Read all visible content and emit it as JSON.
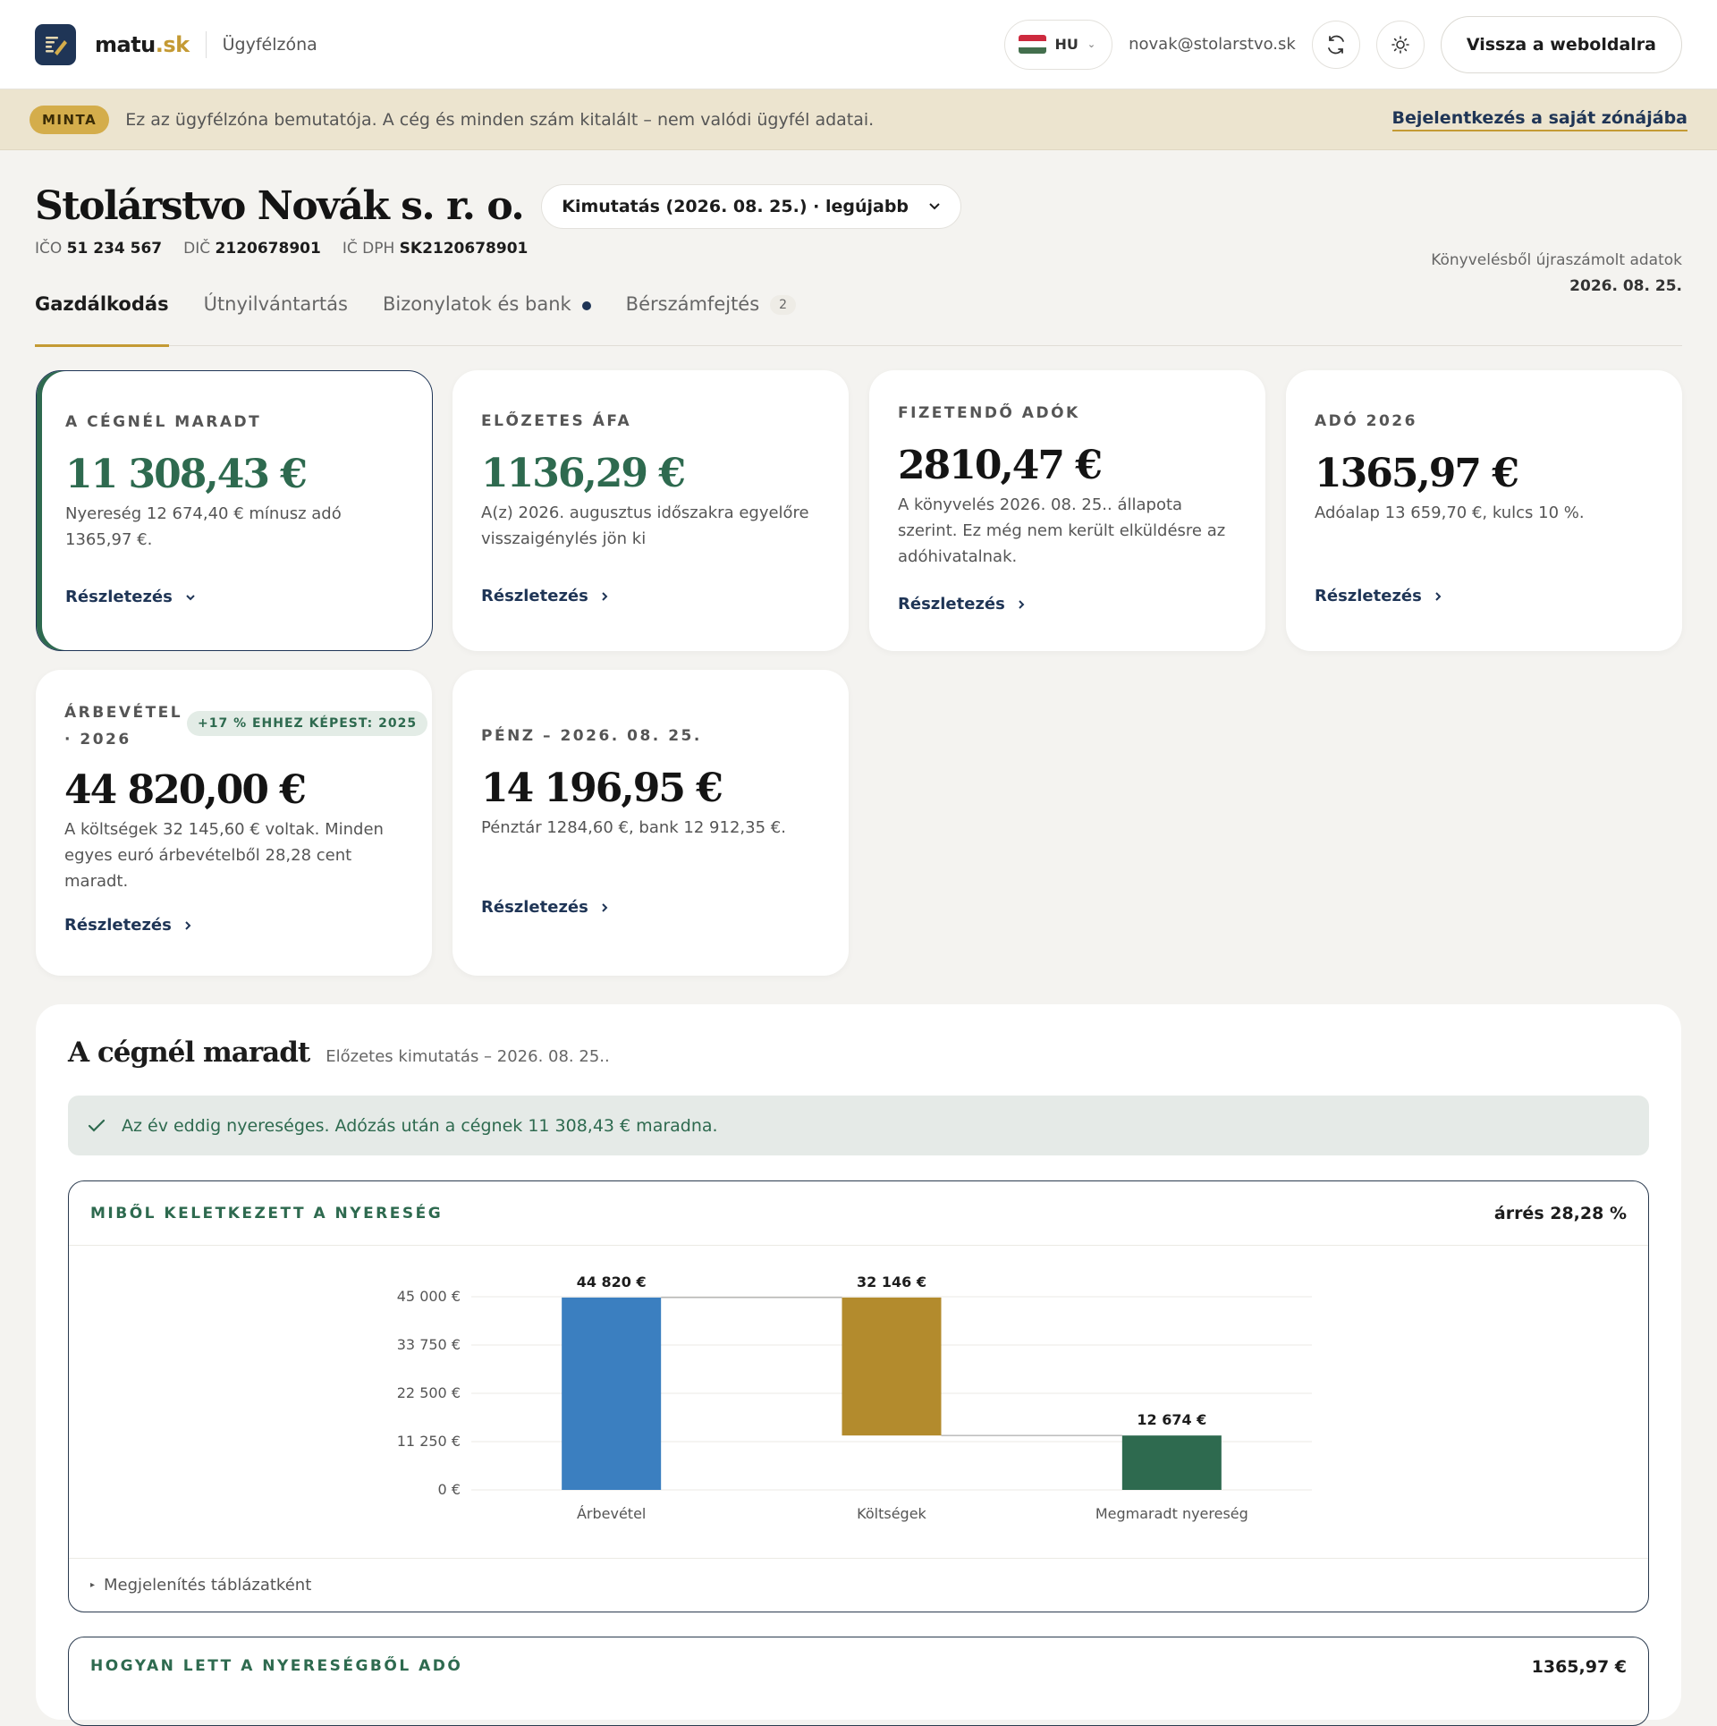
{
  "app": {
    "brand_name": "matu",
    "brand_tld": ".sk",
    "section": "Ügyfélzóna",
    "language": "HU",
    "user_email": "novak@stolarstvo.sk",
    "back_label": "Vissza a weboldalra"
  },
  "banner": {
    "badge": "MINTA",
    "text": "Ez az ügyfélzóna bemutatója. A cég és minden szám kitalált – nem valódi ügyfél adatai.",
    "link": "Bejelentkezés a saját zónájába"
  },
  "company": {
    "name": "Stolárstvo Novák s. r. o.",
    "report_select": "Kimutatás (2026. 08. 25.) · legújabb",
    "ico_label": "IČO",
    "ico": "51 234 567",
    "dic_label": "DIČ",
    "dic": "2120678901",
    "icdph_label": "IČ DPH",
    "icdph": "SK2120678901",
    "recalc_text": "Könyvelésből újraszámolt adatok",
    "recalc_date": "2026. 08. 25."
  },
  "tabs": [
    {
      "label": "Gazdálkodás"
    },
    {
      "label": "Útnyilvántartás"
    },
    {
      "label": "Bizonylatok és bank"
    },
    {
      "label": "Bérszámfejtés",
      "count": "2"
    }
  ],
  "detail_label": "Részletezés",
  "cards": [
    {
      "label": "A cégnél maradt",
      "value": "11 308,43 €",
      "desc": "Nyereség 12 674,40 € mínusz adó 1365,97 €."
    },
    {
      "label": "Előzetes áfa",
      "value": "1136,29 €",
      "desc": "A(z) 2026. augusztus időszakra egyelőre visszaigénylés jön ki"
    },
    {
      "label": "Fizetendő adók",
      "value": "2810,47 €",
      "desc": "A könyvelés 2026. 08. 25.. állapota szerint. Ez még nem került elküldésre az adóhivatalnak."
    },
    {
      "label": "Adó 2026",
      "value": "1365,97 €",
      "desc": "Adóalap 13 659,70 €, kulcs 10 %."
    },
    {
      "label": "Árbevétel · 2026",
      "badge": "+17 % ehhez képest: 2025",
      "value": "44 820,00 €",
      "desc": "A költségek 32 145,60 € voltak. Minden egyes euró árbevételből 28,28 cent maradt."
    },
    {
      "label": "Pénz – 2026. 08. 25.",
      "value": "14 196,95 €",
      "desc": "Pénztár 1284,60 €, bank 12 912,35 €."
    }
  ],
  "profit_panel": {
    "title": "A cégnél maradt",
    "subtitle": "Előzetes kimutatás – 2026. 08. 25..",
    "ok_text": "Az év eddig nyereséges. Adózás után a cégnek 11 308,43 € maradna.",
    "chart_title": "Miből keletkezett a nyereség",
    "margin": "árrés 28,28 %",
    "table_toggle": "Megjelenítés táblázatként",
    "next_title": "Hogyan lett a nyereségből adó",
    "next_value": "1365,97 €"
  },
  "colors": {
    "revenue": "#3b7fc0",
    "costs": "#b38b2d",
    "profit": "#2e6a4f",
    "accent_gold": "#c49a34",
    "navy": "#1f3556"
  },
  "chart_data": {
    "type": "bar",
    "categories": [
      "Árbevétel",
      "Költségek",
      "Megmaradt nyereség"
    ],
    "values": [
      44820,
      32146,
      12674
    ],
    "value_labels": [
      "44 820 €",
      "32 146 €",
      "12 674 €"
    ],
    "bar_bases": [
      0,
      12674,
      0
    ],
    "yticks": [
      0,
      11250,
      22500,
      33750,
      45000
    ],
    "ytick_labels": [
      "0 €",
      "11 250 €",
      "22 500 €",
      "33 750 €",
      "45 000 €"
    ],
    "ylim": [
      0,
      45000
    ],
    "grid": true
  }
}
